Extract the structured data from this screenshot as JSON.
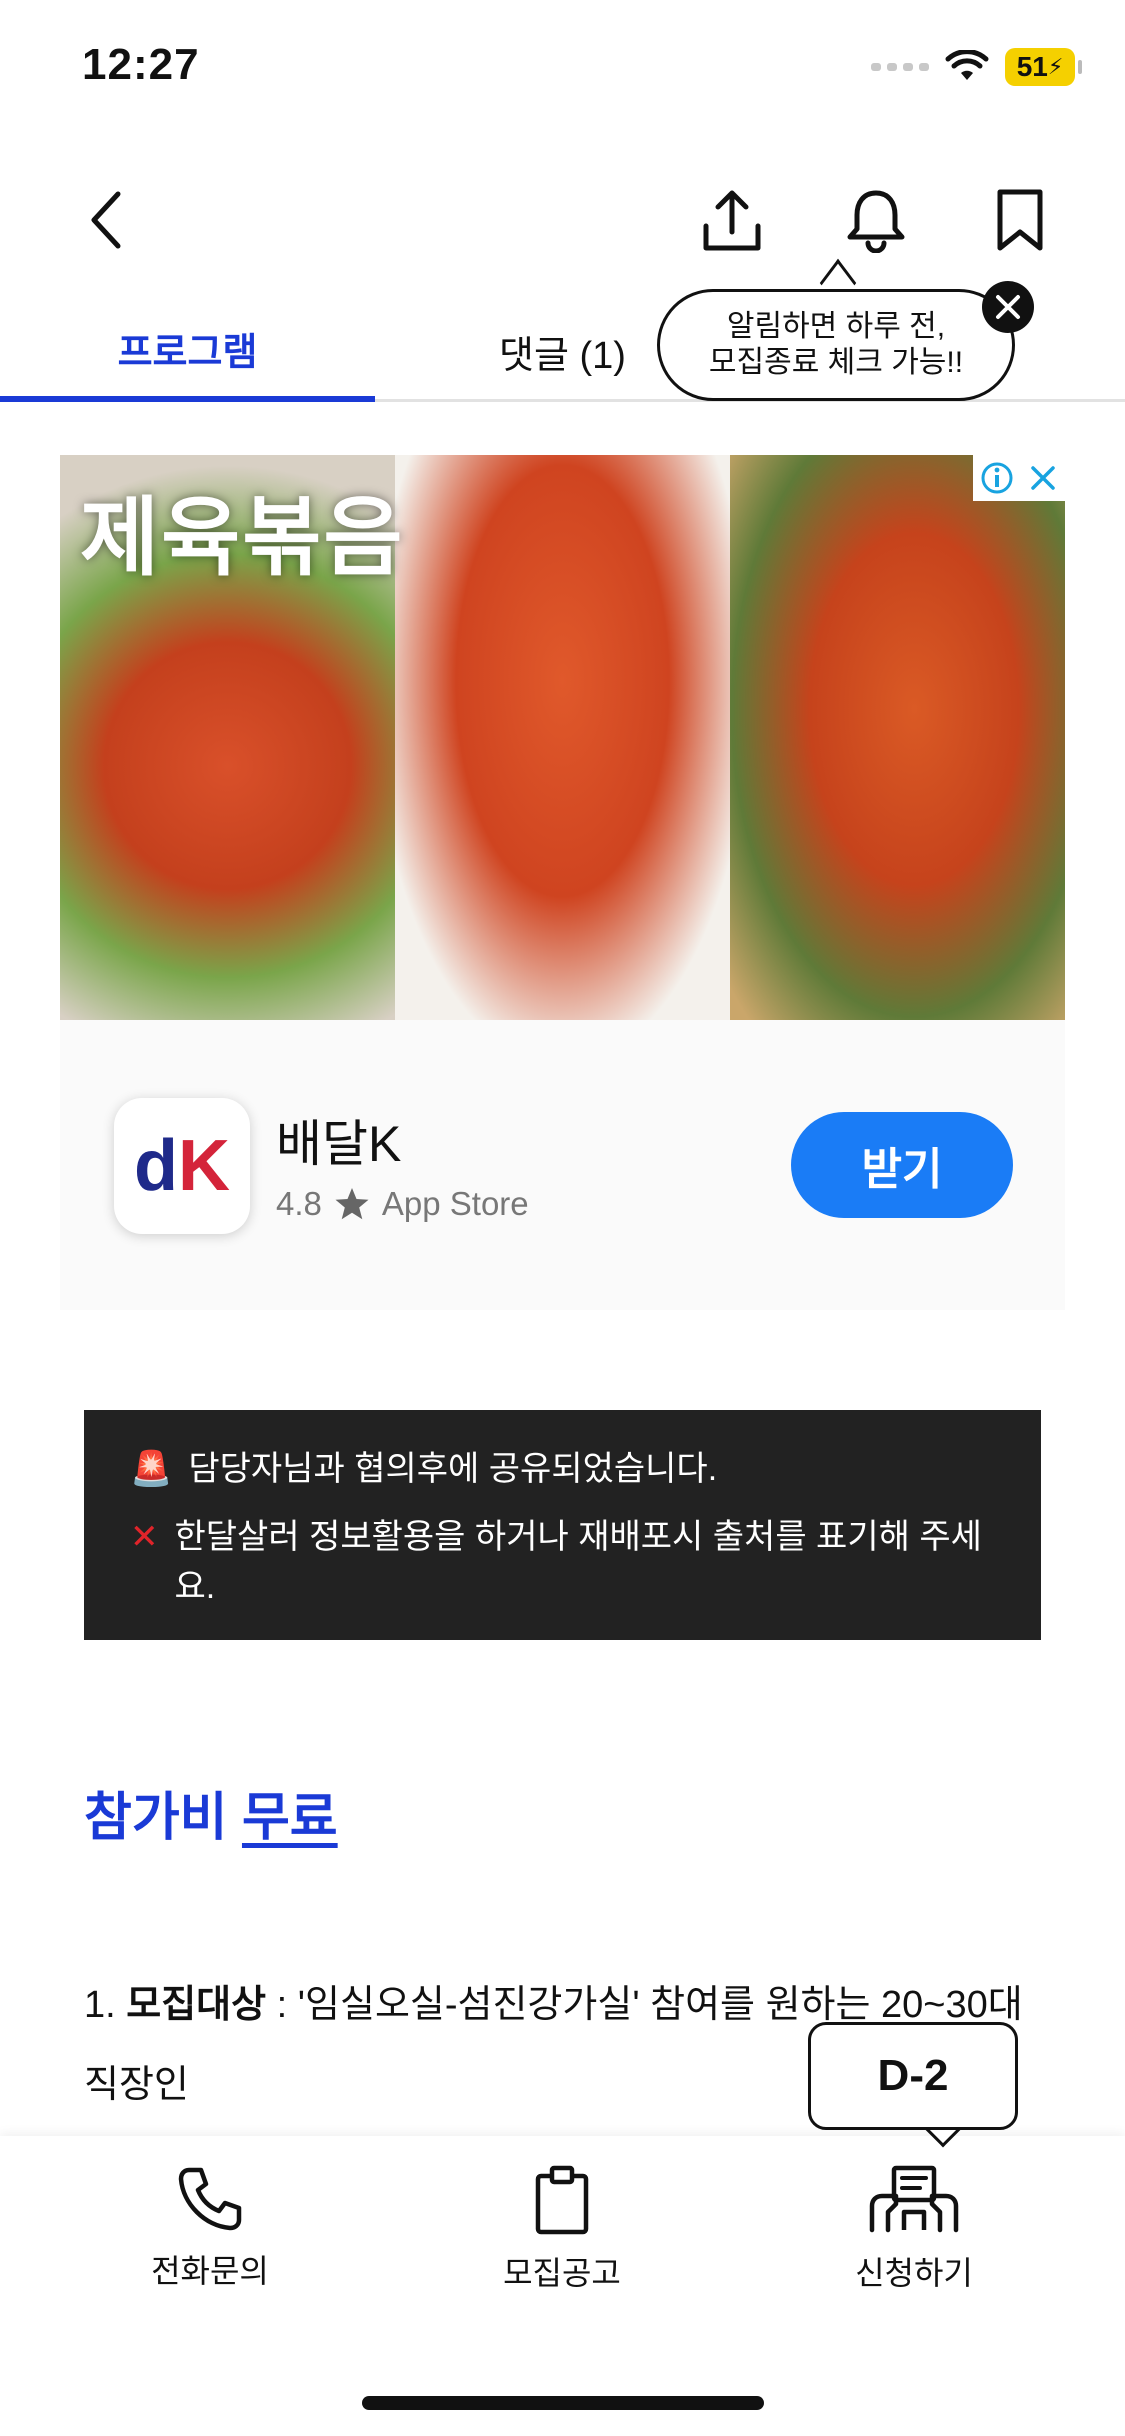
{
  "status_bar": {
    "time": "12:27",
    "battery": "51"
  },
  "nav": {
    "back_icon": "chevron-left-icon",
    "share_icon": "share-icon",
    "bell_icon": "bell-icon",
    "bookmark_icon": "bookmark-icon"
  },
  "tabs": [
    {
      "label": "프로그램",
      "active": true
    },
    {
      "label": "댓글 (1)",
      "active": false
    }
  ],
  "tooltip": {
    "line1": "알림하면 하루 전,",
    "line2": "모집종료 체크 가능!!"
  },
  "ad": {
    "headline": "제육볶음",
    "app_name": "배달K",
    "rating": "4.8",
    "store": "App Store",
    "get_button": "받기",
    "icon_letters": {
      "d": "d",
      "k": "K"
    }
  },
  "notice": {
    "line1": "담당자님과 협의후에 공유되었습니다.",
    "line2": "한달살러 정보활용을 하거나 재배포시 출처를 표기해 주세요."
  },
  "fee": {
    "prefix": "참가비 ",
    "value": "무료"
  },
  "recruit": {
    "number": "1. ",
    "label": "모집대상",
    "text": " : '임실오실-섬진강가실' 참여를 원하는 20~30대 직장인"
  },
  "dday": "D-2",
  "bottom_bar": [
    {
      "label": "전화문의",
      "icon": "phone-icon"
    },
    {
      "label": "모집공고",
      "icon": "clipboard-icon"
    },
    {
      "label": "신청하기",
      "icon": "apply-icon"
    }
  ]
}
